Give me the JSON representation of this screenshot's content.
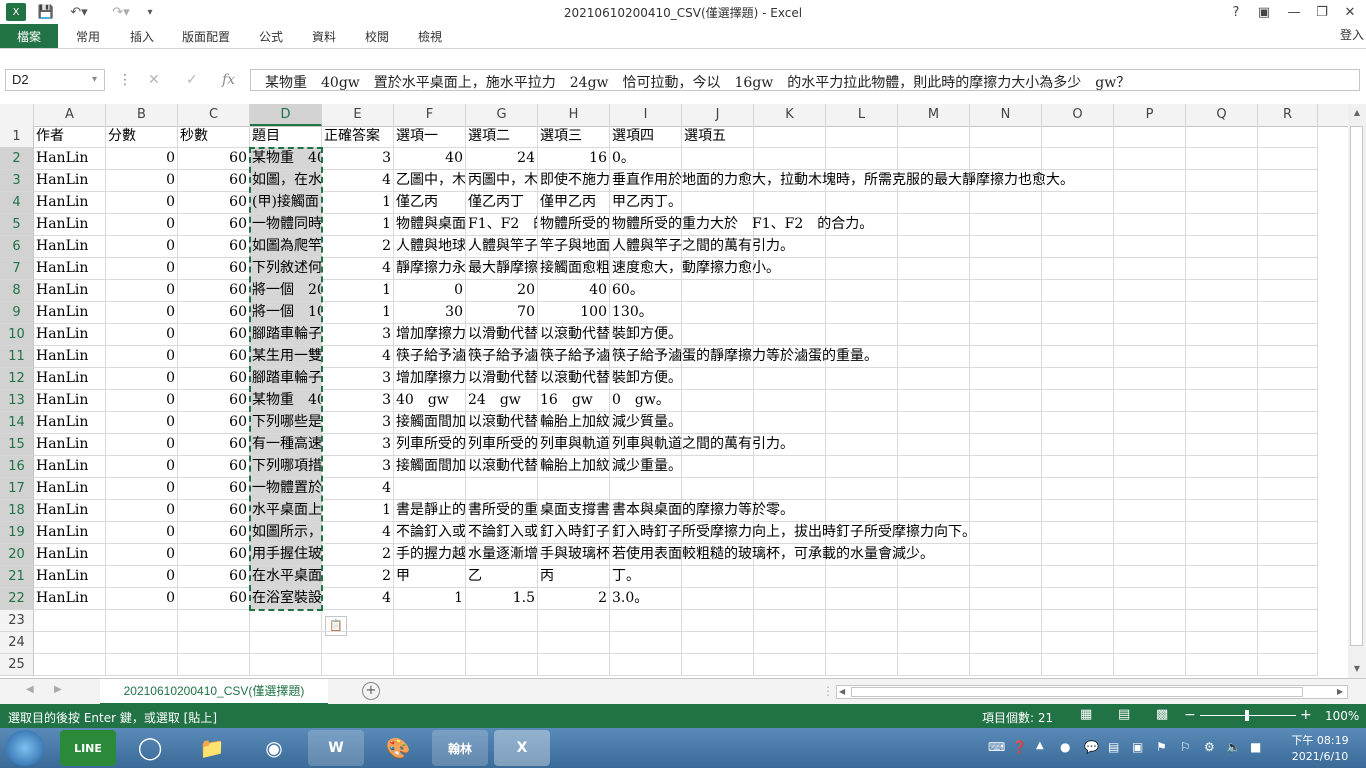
{
  "window": {
    "title": "20210610200410_CSV(僅選擇題) - Excel",
    "help": "?",
    "signin": "登入"
  },
  "ribbon": {
    "tabs": [
      "檔案",
      "常用",
      "插入",
      "版面配置",
      "公式",
      "資料",
      "校閱",
      "檢視"
    ]
  },
  "formula_bar": {
    "name_box": "D2",
    "fx": "fx",
    "content": "某物重　40gw　置於水平桌面上，施水平拉力　24gw　恰可拉動，今以　16gw　的水平力拉此物體，則此時的摩擦力大小為多少　gw？"
  },
  "columns": [
    "A",
    "B",
    "C",
    "D",
    "E",
    "F",
    "G",
    "H",
    "I",
    "J",
    "K",
    "L",
    "M",
    "N",
    "O",
    "P",
    "Q",
    "R"
  ],
  "rows": [
    [
      "作者",
      "分數",
      "秒數",
      "題目",
      "正確答案",
      "選項一",
      "選項二",
      "選項三",
      "選項四",
      "選項五"
    ],
    [
      "HanLin",
      "0",
      "60",
      "某物重　40",
      "3",
      "40",
      "24",
      "16",
      "0。",
      ""
    ],
    [
      "HanLin",
      "0",
      "60",
      "如圖，在水",
      "4",
      "乙圖中，木",
      "丙圖中，木",
      "即使不施力",
      "垂直作用於地面的力愈大，拉動木塊時，所需克服的最大靜摩擦力也愈大。",
      ""
    ],
    [
      "HanLin",
      "0",
      "60",
      "(甲)接觸面",
      "1",
      "僅乙丙",
      "僅乙丙丁",
      "僅甲乙丙",
      "甲乙丙丁。",
      ""
    ],
    [
      "HanLin",
      "0",
      "60",
      "一物體同時",
      "1",
      "物體與桌面",
      "F1、F2　的",
      "物體所受的",
      "物體所受的重力大於　F1、F2　的合力。",
      ""
    ],
    [
      "HanLin",
      "0",
      "60",
      "如圖為爬竿",
      "2",
      "人體與地球",
      "人體與竿子",
      "竿子與地面",
      "人體與竿子之間的萬有引力。",
      ""
    ],
    [
      "HanLin",
      "0",
      "60",
      "下列敘述何",
      "4",
      "靜摩擦力永",
      "最大靜摩擦",
      "接觸面愈粗",
      "速度愈大，動摩擦力愈小。",
      ""
    ],
    [
      "HanLin",
      "0",
      "60",
      "將一個　20",
      "1",
      "0",
      "20",
      "40",
      "60。",
      ""
    ],
    [
      "HanLin",
      "0",
      "60",
      "將一個　10",
      "1",
      "30",
      "70",
      "100",
      "130。",
      ""
    ],
    [
      "HanLin",
      "0",
      "60",
      "腳踏車輪子",
      "3",
      "增加摩擦力",
      "以滑動代替",
      "以滾動代替",
      "裝卸方便。",
      ""
    ],
    [
      "HanLin",
      "0",
      "60",
      "某生用一雙",
      "4",
      "筷子給予滷",
      "筷子給予滷",
      "筷子給予滷",
      "筷子給予滷蛋的靜摩擦力等於滷蛋的重量。",
      ""
    ],
    [
      "HanLin",
      "0",
      "60",
      "腳踏車輪子",
      "3",
      "增加摩擦力",
      "以滑動代替",
      "以滾動代替",
      "裝卸方便。",
      ""
    ],
    [
      "HanLin",
      "0",
      "60",
      "某物重　40",
      "3",
      "40　gw",
      "24　gw",
      "16　gw",
      "0　gw。",
      ""
    ],
    [
      "HanLin",
      "0",
      "60",
      "下列哪些是",
      "3",
      "接觸面間加",
      "以滾動代替",
      "輪胎上加紋",
      "減少質量。",
      ""
    ],
    [
      "HanLin",
      "0",
      "60",
      "有一種高速",
      "3",
      "列車所受的",
      "列車所受的",
      "列車與軌道",
      "列車與軌道之間的萬有引力。",
      ""
    ],
    [
      "HanLin",
      "0",
      "60",
      "下列哪項措",
      "3",
      "接觸面間加",
      "以滾動代替",
      "輪胎上加紋",
      "減少重量。",
      ""
    ],
    [
      "HanLin",
      "0",
      "60",
      "一物體置於",
      "4",
      "",
      "",
      "",
      "",
      ""
    ],
    [
      "HanLin",
      "0",
      "60",
      "水平桌面上",
      "1",
      "書是靜止的",
      "書所受的重",
      "桌面支撐書",
      "書本與桌面的摩擦力等於零。",
      ""
    ],
    [
      "HanLin",
      "0",
      "60",
      "如圖所示，",
      "4",
      "不論釘入或",
      "不論釘入或",
      "釘入時釘子",
      "釘入時釘子所受摩擦力向上，拔出時釘子所受摩擦力向下。",
      ""
    ],
    [
      "HanLin",
      "0",
      "60",
      "用手握住玻",
      "2",
      "手的握力越",
      "水量逐漸增",
      "手與玻璃杯",
      "若使用表面較粗糙的玻璃杯，可承載的水量會減少。",
      ""
    ],
    [
      "HanLin",
      "0",
      "60",
      "在水平桌面",
      "2",
      "甲",
      "乙",
      "丙",
      "丁。",
      ""
    ],
    [
      "HanLin",
      "0",
      "60",
      "在浴室裝設",
      "4",
      "1",
      "1.5",
      "2",
      "3.0。",
      ""
    ]
  ],
  "sheet": {
    "tab_name": "20210610200410_CSV(僅選擇題)",
    "add": "+"
  },
  "status_bar": {
    "message": "選取目的後按 Enter 鍵，或選取 [貼上]",
    "count": "項目個數: 21",
    "zoom": "100%"
  },
  "taskbar": {
    "apps": [
      "LINE",
      "W",
      "翰林",
      "X"
    ],
    "time": "下午 08:19",
    "date": "2021/6/10"
  }
}
